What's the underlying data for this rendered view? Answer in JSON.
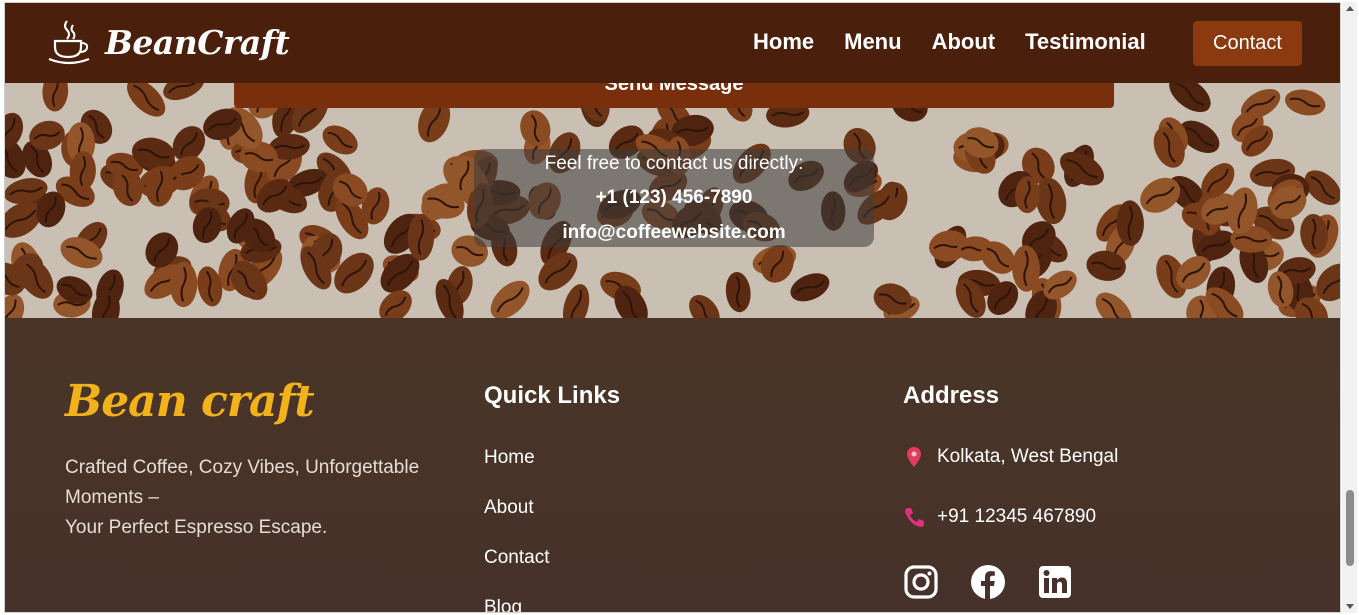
{
  "navbar": {
    "brand": "BeanCraft",
    "brand_icon": "coffee-cup-icon",
    "links": [
      "Home",
      "Menu",
      "About",
      "Testimonial"
    ],
    "contact_label": "Contact",
    "background": "#4a1f0b",
    "accent": "#8b3a10"
  },
  "hero": {
    "send_label": "Send Message",
    "contact_intro": "Feel free to contact us directly:",
    "phone": "+1 (123) 456-7890",
    "email": "info@coffeewebsite.com"
  },
  "footer": {
    "logo": "Bean craft",
    "logo_color": "#f2b21b",
    "tagline_line1": "Crafted Coffee, Cozy Vibes, Unforgettable Moments –",
    "tagline_line2": "Your Perfect Espresso Escape.",
    "quick_links_heading": "Quick Links",
    "quick_links": [
      "Home",
      "About",
      "Contact",
      "Blog"
    ],
    "address_heading": "Address",
    "address_location": "Kolkata, West Bengal",
    "address_phone": "+91 12345 467890",
    "social_icons": [
      "instagram-icon",
      "facebook-icon",
      "linkedin-icon"
    ]
  }
}
